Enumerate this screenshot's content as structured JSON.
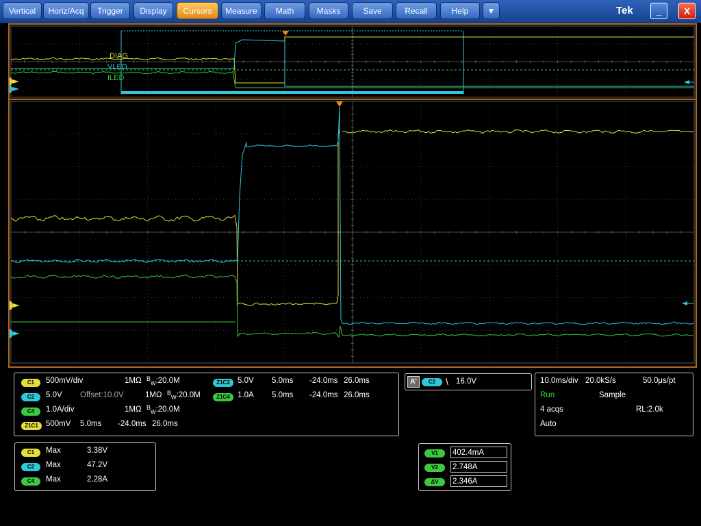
{
  "menu": [
    {
      "label": "Vertical",
      "active": false
    },
    {
      "label": "Horiz/Acq",
      "active": false
    },
    {
      "label": "Trigger",
      "active": false
    },
    {
      "label": "Display",
      "active": false
    },
    {
      "label": "Cursors",
      "active": true
    },
    {
      "label": "Measure",
      "active": false
    },
    {
      "label": "Math",
      "active": false
    },
    {
      "label": "Masks",
      "active": false
    },
    {
      "label": "Save",
      "active": false
    },
    {
      "label": "Recall",
      "active": false
    },
    {
      "label": "Help",
      "active": false
    }
  ],
  "menu_dropdown_glyph": "▼",
  "brand": "Tek",
  "window": {
    "minimize_glyph": "_",
    "close_glyph": "X"
  },
  "colors": {
    "ch1": "#e4df3a",
    "ch2": "#2fc8d8",
    "ch4": "#3cc840",
    "frame": "#b06a28",
    "run": "#2ee02e"
  },
  "overview": {
    "labels": [
      "DIAG",
      "VLED",
      "ILED"
    ],
    "marker_ch1": "1",
    "marker_ch2": "2"
  },
  "main_markers": {
    "ch1": "1",
    "ch2": "2"
  },
  "channels": {
    "c1": {
      "badge": "C1",
      "scale": "500mV/div",
      "imp": "1MΩ",
      "bw_prefix": "B",
      "bw_sub": "W",
      "bw": ":20.0M"
    },
    "c2": {
      "badge": "C2",
      "scale": "5.0V",
      "offset": "Offset:10.0V",
      "imp": "1MΩ",
      "bw_prefix": "B",
      "bw_sub": "W",
      "bw": ":20.0M"
    },
    "c4": {
      "badge": "C4",
      "scale": "1.0A/div",
      "imp": "1MΩ",
      "bw_prefix": "B",
      "bw_sub": "W",
      "bw": ":20.0M"
    }
  },
  "zooms": {
    "z1c2": {
      "badge": "Z1C2",
      "scale": "5.0V",
      "time": "5.0ms",
      "start": "-24.0ms",
      "end": "26.0ms"
    },
    "z1c4": {
      "badge": "Z1C4",
      "scale": "1.0A",
      "time": "5.0ms",
      "start": "-24.0ms",
      "end": "26.0ms"
    },
    "z1c1": {
      "badge": "Z1C1",
      "scale": "500mV",
      "time": "5.0ms",
      "start": "-24.0ms",
      "end": "26.0ms"
    }
  },
  "trigger": {
    "mode": "A'",
    "source": "C2",
    "slope_glyph": "\\",
    "level": "16.0V"
  },
  "acquisition": {
    "timebase": "10.0ms/div",
    "sample_rate": "20.0kS/s",
    "resolution": "50.0μs/pt",
    "state": "Run",
    "mode": "Sample",
    "acqs": "4 acqs",
    "record_length": "RL:2.0k",
    "trigger_mode": "Auto"
  },
  "measurements": [
    {
      "badge": "C1",
      "type": "Max",
      "value": "3.38V"
    },
    {
      "badge": "C2",
      "type": "Max",
      "value": "47.2V"
    },
    {
      "badge": "C4",
      "type": "Max",
      "value": "2.28A"
    }
  ],
  "cursors": [
    {
      "badge": "V1",
      "value": "402.4mA"
    },
    {
      "badge": "V2",
      "value": "2.748A"
    },
    {
      "badge": "ΔV",
      "value": "2.346A"
    }
  ]
}
